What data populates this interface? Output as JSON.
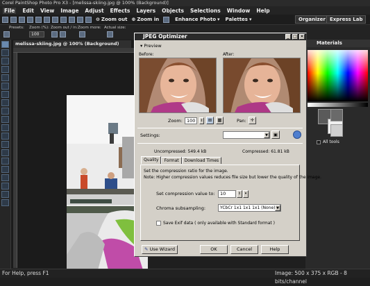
{
  "app": {
    "title": "Corel PaintShop Photo Pro X3 - [melissa-skiing.jpg @ 100% (Background)]"
  },
  "menu": [
    "File",
    "Edit",
    "View",
    "Image",
    "Adjust",
    "Effects",
    "Layers",
    "Objects",
    "Selections",
    "Window",
    "Help"
  ],
  "toolbar": {
    "zoom_out": "Zoom out",
    "zoom_in": "Zoom in",
    "enhance": "Enhance Photo",
    "palettes": "Palettes",
    "organizer": "Organizer",
    "express_lab": "Express Lab"
  },
  "options": {
    "presets": "Presets:",
    "zoom_label": "Zoom (%):",
    "zoom_value": "100",
    "zoom_out_label": "Zoom out / in:",
    "zoom_more": "Zoom more:",
    "actual_size": "Actual size:"
  },
  "document": {
    "tab": "melissa-skiing.jpg @ 100% (Background)"
  },
  "materials": {
    "title": "Materials",
    "all_tools": "All tools"
  },
  "status": {
    "help": "For Help, press F1",
    "image_info": "Image:  500 x 375 x RGB - 8 bits/channel"
  },
  "dialog": {
    "title": "JPEG Optimizer",
    "preview": "Preview",
    "before": "Before:",
    "after": "After:",
    "zoom_label": "Zoom:",
    "zoom_value": "100",
    "pan_label": "Pan:",
    "settings_label": "Settings:",
    "uncompressed": "Uncompressed:  549.4 kB",
    "compressed": "Compressed:  61.81 kB",
    "tabs": [
      "Quality",
      "Format",
      "Download Times"
    ],
    "instructions": "Set the compression ratio for the image.",
    "note": "Note:  Higher compression values reduces file size but lower the quality of the image.",
    "compression_label": "Set compression value to:",
    "compression_value": "10",
    "chroma_label": "Chroma subsampling:",
    "chroma_value": "YCbCr  1x1  1x1  1x1  (None)",
    "exif_label": "Save Exif data ( only available with Standard format )",
    "use_wizard": "Use Wizard",
    "ok": "OK",
    "cancel": "Cancel",
    "help": "Help"
  }
}
